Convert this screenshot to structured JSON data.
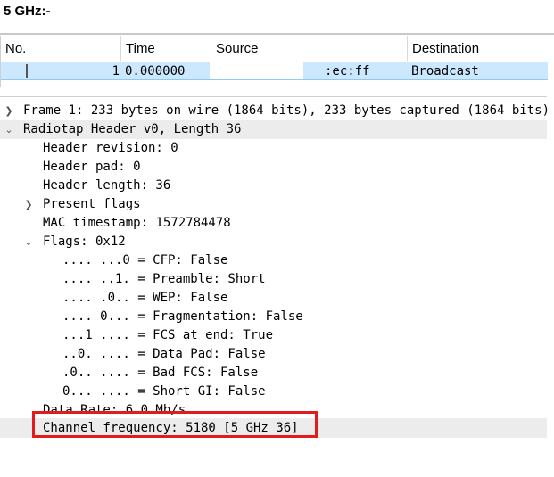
{
  "heading": "5 GHz:-",
  "packet_list": {
    "columns": [
      "No.",
      "Time",
      "Source",
      "Destination"
    ],
    "selected_row": {
      "no": "1",
      "time": "0.000000",
      "source": ":ec:ff",
      "destination": "Broadcast"
    }
  },
  "details": {
    "frame": "Frame 1: 233 bytes on wire (1864 bits), 233 bytes captured (1864 bits)",
    "radiotap": "Radiotap Header v0, Length 36",
    "header_revision": "Header revision: 0",
    "header_pad": "Header pad: 0",
    "header_length": "Header length: 36",
    "present_flags": "Present flags",
    "mac_timestamp": "MAC timestamp: 1572784478",
    "flags": "Flags: 0x12",
    "flag_cfp": ".... ...0 = CFP: False",
    "flag_preamble": ".... ..1. = Preamble: Short",
    "flag_wep": ".... .0.. = WEP: False",
    "flag_fragmentation": ".... 0... = Fragmentation: False",
    "flag_fcs_at_end": "...1 .... = FCS at end: True",
    "flag_data_pad": "..0. .... = Data Pad: False",
    "flag_bad_fcs": ".0.. .... = Bad FCS: False",
    "flag_short_gi": "0... .... = Short GI: False",
    "data_rate": "Data Rate: 6.0 Mb/s",
    "channel_frequency": "Channel frequency: 5180 [5 GHz 36]"
  },
  "icons": {
    "collapsed": "chevron-right-icon",
    "expanded": "chevron-down-icon"
  },
  "colors": {
    "selection": "#cce8ff",
    "highlight_border": "#e31b1b",
    "band": "#ececec"
  }
}
